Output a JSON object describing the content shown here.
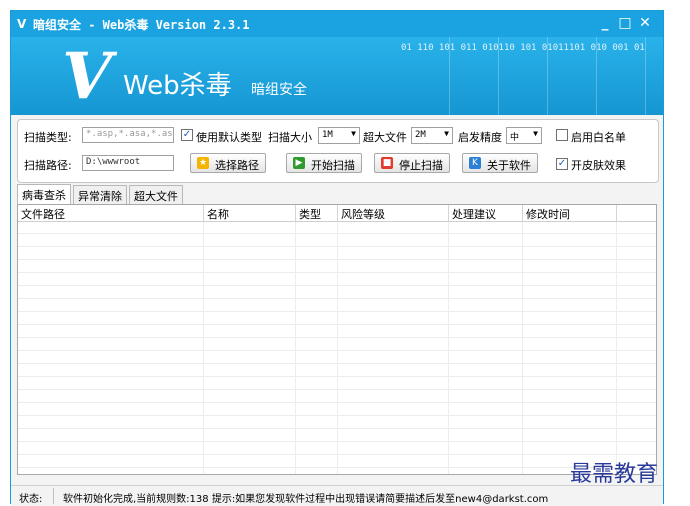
{
  "window": {
    "logo_glyph": "V",
    "title": "暗组安全 - Web杀毒  Version 2.3.1",
    "minimize": "_",
    "maximize": "□",
    "close": "✕"
  },
  "banner": {
    "logo_glyph": "V",
    "title": "Web杀毒",
    "subtitle": "暗组安全",
    "binary_text": "01 110 101 011 010110 101 01011101 010 001 01"
  },
  "scan": {
    "type_label": "扫描类型:",
    "type_placeholder": "*.asp,*.asa,*.as",
    "default_type_label": "使用默认类型",
    "default_type_checked": true,
    "size_label": "扫描大小",
    "size_value": "1M",
    "large_file_label": "超大文件",
    "large_file_value": "2M",
    "heuristic_label": "启发精度",
    "heuristic_value": "中",
    "whitelist_label": "启用白名单",
    "whitelist_checked": false,
    "path_label": "扫描路径:",
    "path_value": "D:\\wwwroot",
    "skin_label": "开皮肤效果",
    "skin_checked": true
  },
  "buttons": {
    "choose_path": "选择路径",
    "start_scan": "开始扫描",
    "stop_scan": "停止扫描",
    "about": "关于软件"
  },
  "tabs": [
    {
      "label": "病毒查杀",
      "active": true
    },
    {
      "label": "异常清除",
      "active": false
    },
    {
      "label": "超大文件",
      "active": false
    }
  ],
  "table": {
    "columns": [
      "文件路径",
      "名称",
      "类型",
      "风险等级",
      "处理建议",
      "修改时间"
    ],
    "rows": []
  },
  "status": {
    "label": "状态:",
    "text": "软件初始化完成,当前规则数:138 提示:如果您发现软件过程中出现错误请简要描述后发至new4@darkst.com"
  },
  "watermark": "最需教育",
  "colors": {
    "titlebar": "#1aa3e0",
    "banner": "#1596d2",
    "check": "#1a5fb4"
  }
}
